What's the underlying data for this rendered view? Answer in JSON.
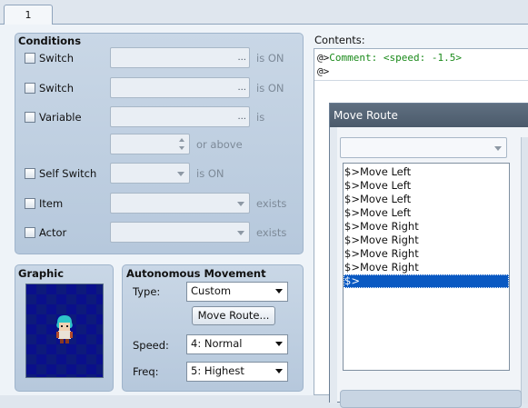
{
  "tabs": [
    {
      "label": "1"
    }
  ],
  "conditions": {
    "title": "Conditions",
    "switch1": {
      "label": "Switch",
      "value": "",
      "suffix": "is ON"
    },
    "switch2": {
      "label": "Switch",
      "value": "",
      "suffix": "is ON"
    },
    "variable": {
      "label": "Variable",
      "value": "",
      "suffix": "is",
      "amount": "",
      "amount_suffix": "or above"
    },
    "self_switch": {
      "label": "Self Switch",
      "value": "",
      "suffix": "is ON"
    },
    "item": {
      "label": "Item",
      "value": "",
      "suffix": "exists"
    },
    "actor": {
      "label": "Actor",
      "value": "",
      "suffix": "exists"
    },
    "ellipsis": "..."
  },
  "graphic": {
    "title": "Graphic"
  },
  "autonomous": {
    "title": "Autonomous Movement",
    "type_label": "Type:",
    "type_value": "Custom",
    "move_route_button": "Move Route...",
    "speed_label": "Speed:",
    "speed_value": "4: Normal",
    "freq_label": "Freq:",
    "freq_value": "5: Highest"
  },
  "contents": {
    "label": "Contents:",
    "lines": [
      {
        "prefix": "@>",
        "text": "Comment: <speed: -1.5>"
      },
      {
        "prefix": "@>",
        "text": ""
      }
    ]
  },
  "move_route": {
    "title": "Move Route",
    "target_value": "",
    "list": [
      "$>Move Left",
      "$>Move Left",
      "$>Move Left",
      "$>Move Left",
      "$>Move Right",
      "$>Move Right",
      "$>Move Right",
      "$>Move Right",
      "$>"
    ],
    "selected_index": 8
  },
  "colors": {
    "comment_green": "#1a8a1a",
    "selection_blue": "#0a59c2",
    "panel_blue": "#c3d3e4"
  }
}
